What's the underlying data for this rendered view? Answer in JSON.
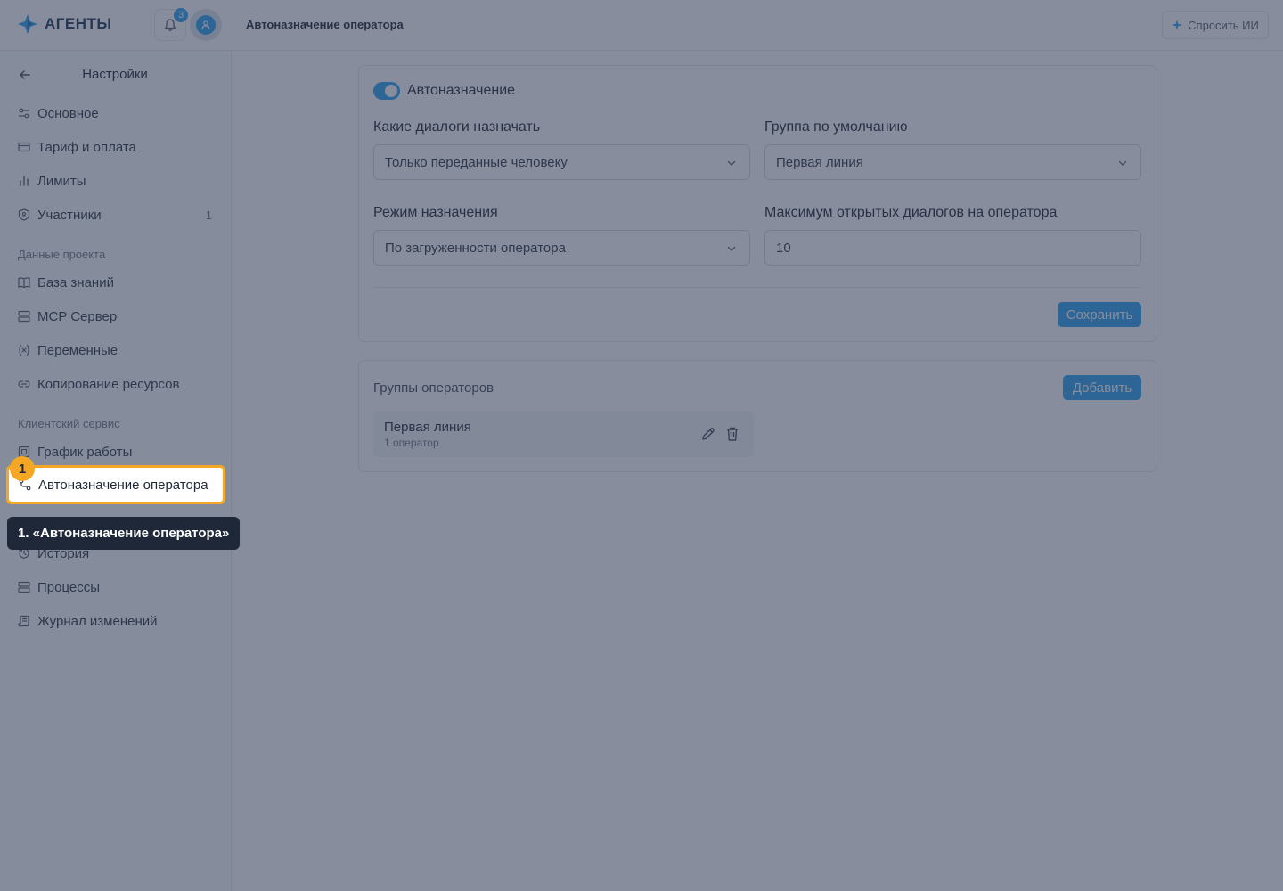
{
  "brand": {
    "name": "АГЕНТЫ"
  },
  "header": {
    "title": "Автоназначение оператора",
    "notifications_count": "3",
    "ask_ai_label": "Спросить ИИ"
  },
  "sidebar": {
    "title": "Настройки",
    "items_main": [
      {
        "label": "Основное",
        "icon": "sliders-icon"
      },
      {
        "label": "Тариф и оплата",
        "icon": "credit-card-icon"
      },
      {
        "label": "Лимиты",
        "icon": "bar-chart-icon"
      },
      {
        "label": "Участники",
        "icon": "shield-user-icon",
        "count": "1"
      }
    ],
    "section_project": "Данные проекта",
    "items_project": [
      {
        "label": "База знаний",
        "icon": "book-icon"
      },
      {
        "label": "MCP Сервер",
        "icon": "server-icon"
      },
      {
        "label": "Переменные",
        "icon": "variable-icon"
      },
      {
        "label": "Копирование ресурсов",
        "icon": "link-icon"
      }
    ],
    "section_service": "Клиентский сервис",
    "items_service": [
      {
        "label": "График работы",
        "icon": "calendar-icon"
      },
      {
        "label": "Автоназначение оператора",
        "icon": "route-icon"
      },
      {
        "label": "",
        "icon": ""
      },
      {
        "label": "История",
        "icon": "history-icon"
      },
      {
        "label": "Процессы",
        "icon": "server-icon"
      },
      {
        "label": "Журнал изменений",
        "icon": "scroll-icon"
      }
    ]
  },
  "autoassign": {
    "toggle_label": "Автоназначение",
    "toggle_on": true,
    "which_dialogs_label": "Какие диалоги назначать",
    "which_dialogs_value": "Только переданные человеку",
    "default_group_label": "Группа по умолчанию",
    "default_group_value": "Первая линия",
    "mode_label": "Режим назначения",
    "mode_value": "По загруженности оператора",
    "max_dialogs_label": "Максимум открытых диалогов на оператора",
    "max_dialogs_value": "10",
    "save_label": "Сохранить"
  },
  "groups": {
    "title": "Группы операторов",
    "add_label": "Добавить",
    "items": [
      {
        "name": "Первая линия",
        "sub": "1 оператор"
      }
    ]
  },
  "tour": {
    "step_number": "1",
    "tooltip_text": "1. «Автоназначение оператора»"
  },
  "colors": {
    "accent": "#1d9bf0",
    "highlight": "#f5a623",
    "overlay": "#37415a"
  }
}
